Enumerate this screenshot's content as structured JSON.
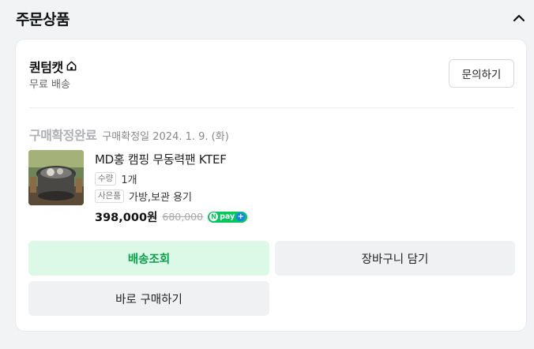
{
  "section": {
    "title": "주문상품"
  },
  "seller": {
    "name": "퀀텀캣",
    "shipping": "무료 배송",
    "inquiry_button": "문의하기"
  },
  "order": {
    "status": "구매확정완료",
    "status_date": "구매확정일 2024. 1. 9. (화)"
  },
  "product": {
    "name": "MD홍 캠핑 무동력팬 KTEF",
    "options": [
      {
        "tag": "수량",
        "value": "1개"
      },
      {
        "tag": "사은품",
        "value": "가방,보관 용기"
      }
    ],
    "price": "398,000원",
    "original_price": "680,000",
    "pay_badge": "pay"
  },
  "buttons": {
    "track": "배송조회",
    "cart": "장바구니 담기",
    "rebuy": "바로 구매하기"
  },
  "colors": {
    "accent_green": "#03c75a",
    "track_bg": "#dcf8e6",
    "track_text": "#0aa14a"
  },
  "icons": [
    "chevron-up-icon",
    "home-icon",
    "npay-icon"
  ]
}
